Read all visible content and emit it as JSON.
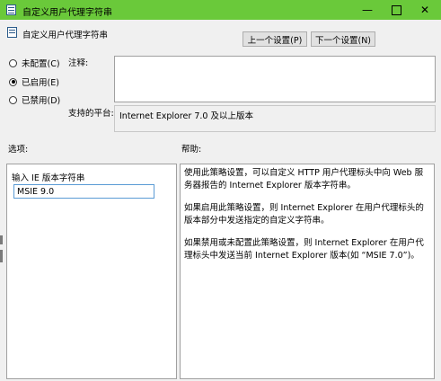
{
  "window": {
    "title": "自定义用户代理字符串",
    "minimize": "—",
    "close": "✕"
  },
  "header": {
    "title": "自定义用户代理字符串",
    "prev_label": "上一个设置(P)",
    "next_label": "下一个设置(N)"
  },
  "state": {
    "options": [
      {
        "label": "未配置(C)",
        "selected": false
      },
      {
        "label": "已启用(E)",
        "selected": true
      },
      {
        "label": "已禁用(D)",
        "selected": false
      }
    ]
  },
  "comment": {
    "label": "注释:",
    "value": ""
  },
  "platform": {
    "label": "支持的平台:",
    "value": "Internet Explorer 7.0 及以上版本"
  },
  "options_panel": {
    "label": "选项:",
    "field_label": "输入 IE 版本字符串",
    "field_value": "MSIE 9.0"
  },
  "help_panel": {
    "label": "帮助:",
    "paragraphs": [
      "使用此策略设置，可以自定义 HTTP 用户代理标头中向 Web 服务器报告的 Internet Explorer 版本字符串。",
      "如果启用此策略设置，则 Internet Explorer 在用户代理标头的版本部分中发送指定的自定义字符串。",
      "如果禁用或未配置此策略设置，则 Internet Explorer 在用户代理标头中发送当前 Internet Explorer 版本(如 “MSIE 7.0”)。"
    ]
  },
  "colors": {
    "titlebar": "#6ac93a",
    "background": "#f0f0f0",
    "input_border": "#5b9bd5"
  },
  "icons": [
    "policy-icon",
    "minimize-icon",
    "maximize-icon",
    "close-icon"
  ]
}
